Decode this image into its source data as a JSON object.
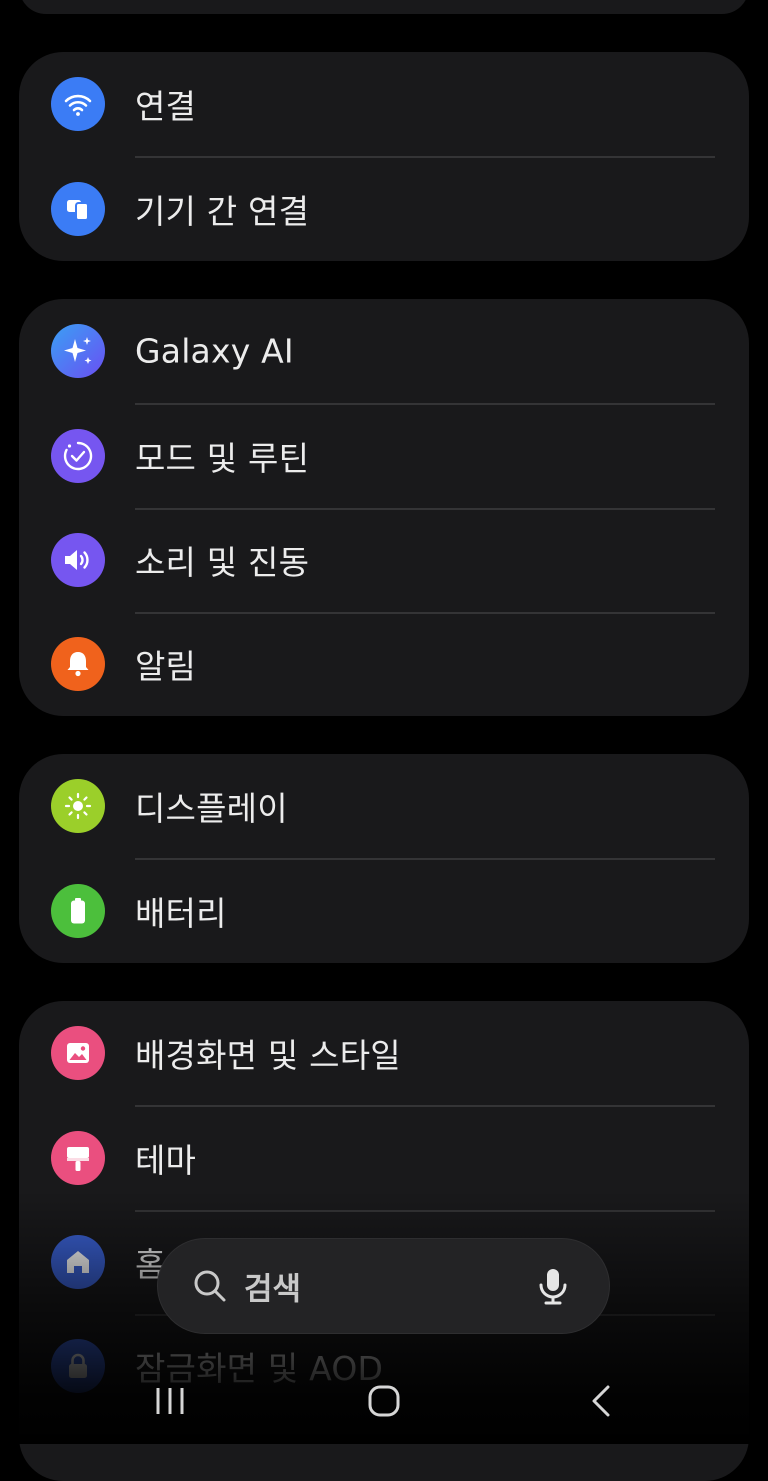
{
  "settings": {
    "group_connect": {
      "items": [
        {
          "label": "연결",
          "icon": "wifi-icon",
          "color": "#3b7cf5"
        },
        {
          "label": "기기 간 연결",
          "icon": "device-connect-icon",
          "color": "#3b7cf5"
        }
      ]
    },
    "group_ai": {
      "items": [
        {
          "label": "Galaxy AI",
          "icon": "sparkle-icon",
          "color": "#4a6cf7"
        },
        {
          "label": "모드 및 루틴",
          "icon": "routine-check-icon",
          "color": "#7656f0"
        },
        {
          "label": "소리 및 진동",
          "icon": "speaker-icon",
          "color": "#7656f0"
        },
        {
          "label": "알림",
          "icon": "bell-icon",
          "color": "#f0621c"
        }
      ]
    },
    "group_display": {
      "items": [
        {
          "label": "디스플레이",
          "icon": "sun-icon",
          "color": "#9bcf2a"
        },
        {
          "label": "배터리",
          "icon": "battery-icon",
          "color": "#4cbf3c"
        }
      ]
    },
    "group_style": {
      "items": [
        {
          "label": "배경화면 및 스타일",
          "icon": "wallpaper-icon",
          "color": "#ea4f7f"
        },
        {
          "label": "테마",
          "icon": "paint-brush-icon",
          "color": "#ea4f7f"
        },
        {
          "label": "홈",
          "icon": "home-icon",
          "color": "#3b62d6"
        },
        {
          "label": "잠금화면 및 AOD",
          "icon": "lock-icon",
          "color": "#3b62d6"
        }
      ]
    }
  },
  "search": {
    "label": "검색",
    "icon": "search-icon",
    "mic_icon": "mic-icon"
  },
  "navbar": {
    "recents_icon": "recents-icon",
    "home_icon": "home-nav-icon",
    "back_icon": "back-icon"
  }
}
